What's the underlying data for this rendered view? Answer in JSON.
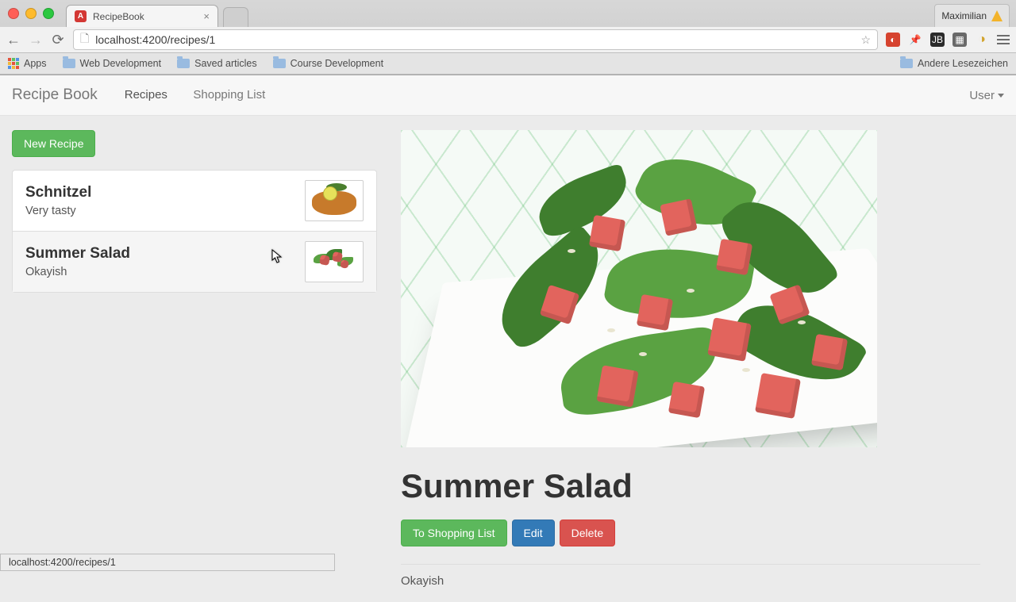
{
  "browser": {
    "tab_title": "RecipeBook",
    "profile_name": "Maximilian",
    "url": "localhost:4200/recipes/1",
    "bookmarks": {
      "apps": "Apps",
      "items": [
        "Web Development",
        "Saved articles",
        "Course Development"
      ],
      "right": "Andere Lesezeichen"
    },
    "status_bar": "localhost:4200/recipes/1"
  },
  "nav": {
    "brand": "Recipe Book",
    "links": {
      "recipes": "Recipes",
      "shopping": "Shopping List"
    },
    "user": "User"
  },
  "recipes": {
    "new_button": "New Recipe",
    "items": [
      {
        "name": "Schnitzel",
        "desc": "Very tasty"
      },
      {
        "name": "Summer Salad",
        "desc": "Okayish"
      }
    ]
  },
  "detail": {
    "title": "Summer Salad",
    "to_shopping": "To Shopping List",
    "edit": "Edit",
    "delete": "Delete",
    "description": "Okayish"
  },
  "colors": {
    "success": "#5cb85c",
    "primary": "#337ab7",
    "danger": "#d9534f"
  }
}
